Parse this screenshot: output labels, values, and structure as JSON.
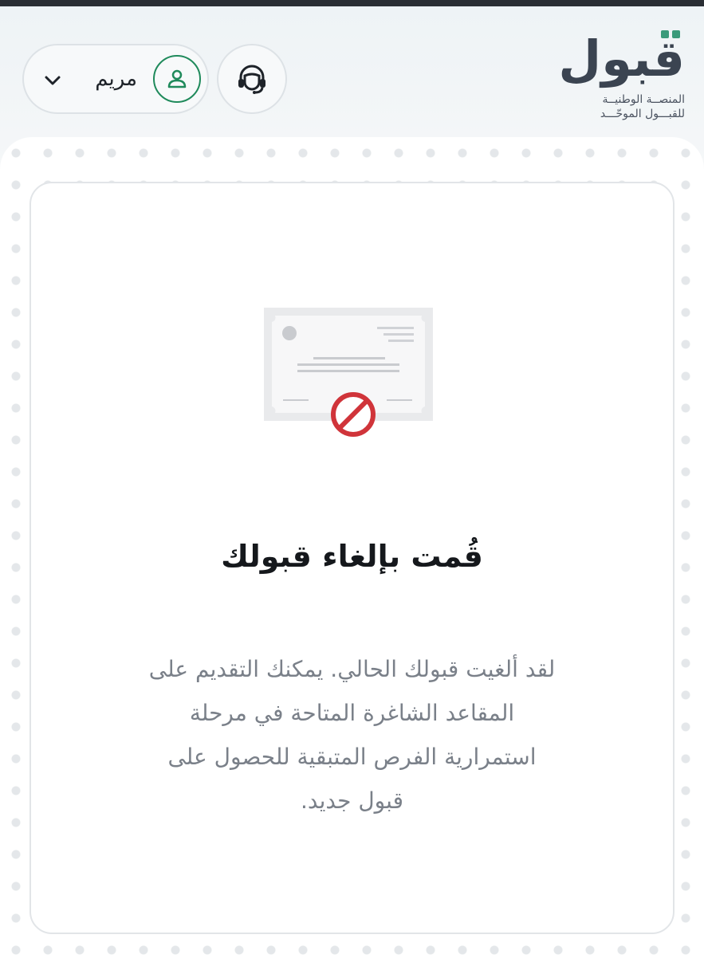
{
  "header": {
    "logo_word": "قبول",
    "logo_line1": "المنصــة الوطنيــة",
    "logo_line2": "للقبـــول الموحّـــد",
    "support_icon": "headset-icon",
    "user": {
      "name": "مريم",
      "avatar_icon": "user-icon",
      "chevron_icon": "chevron-down-icon"
    }
  },
  "card": {
    "illustration_icon": "cancelled-certificate-icon",
    "title": "قُمت بإلغاء قبولك",
    "description": "لقد ألغيت قبولك الحالي. يمكنك التقديم على المقاعد الشاغرة المتاحة في مرحلة استمرارية الفرص المتبقية للحصول على قبول جديد."
  },
  "colors": {
    "brand_dark": "#3b4451",
    "brand_green": "#1f8a5b",
    "cancel_red": "#d0343a"
  }
}
